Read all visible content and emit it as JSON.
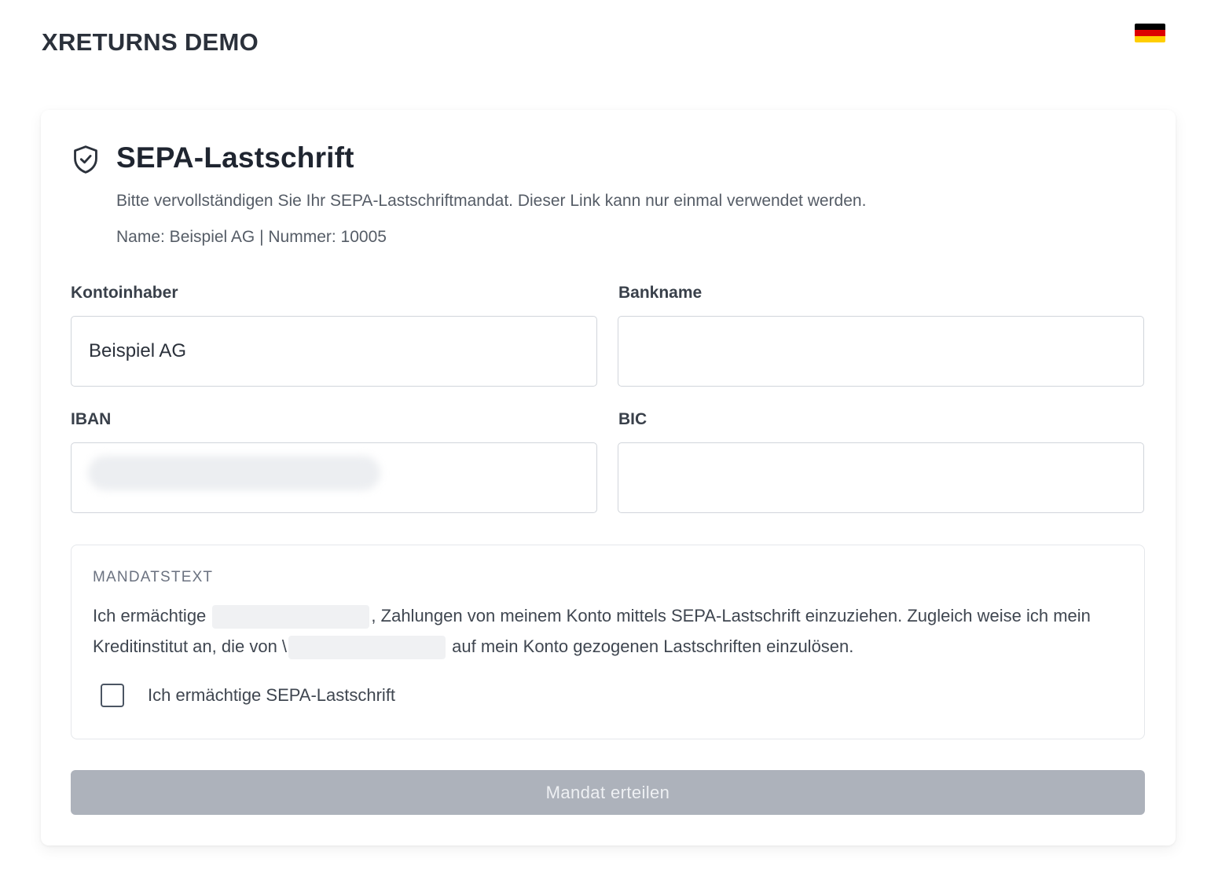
{
  "header": {
    "brand": "XRETURNS DEMO",
    "language_flag": "german-flag-icon",
    "flag_colors": [
      "#000000",
      "#dd0000",
      "#ffce00"
    ]
  },
  "card": {
    "icon": "shield-check-icon",
    "title": "SEPA-Lastschrift",
    "subtitle": "Bitte vervollständigen Sie Ihr SEPA-Lastschriftmandat. Dieser Link kann nur einmal verwendet werden.",
    "meta": "Name: Beispiel AG | Nummer: 10005"
  },
  "form": {
    "account_holder": {
      "label": "Kontoinhaber",
      "value": "Beispiel AG"
    },
    "bank_name": {
      "label": "Bankname",
      "value": ""
    },
    "iban": {
      "label": "IBAN",
      "value": ""
    },
    "bic": {
      "label": "BIC",
      "value": ""
    }
  },
  "mandate": {
    "title": "MANDATSTEXT",
    "text_part1": "Ich ermächtige",
    "text_part2": ", Zahlungen von meinem Konto mittels SEPA-Lastschrift einzuziehen. Zugleich weise ich mein Kreditinstitut an, die von \\",
    "text_part3": "auf mein Konto gezogenen Lastschriften einzulösen.",
    "checkbox_label": "Ich ermächtige SEPA-Lastschrift",
    "checkbox_checked": false
  },
  "submit": {
    "label": "Mandat erteilen",
    "disabled": true
  },
  "colors": {
    "button_disabled": "#adb2bb",
    "border": "#d1d5db"
  }
}
